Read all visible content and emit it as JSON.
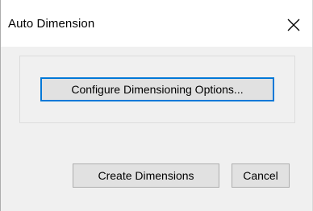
{
  "dialog": {
    "title": "Auto Dimension"
  },
  "buttons": {
    "configure_label": "Configure Dimensioning Options...",
    "create_label": "Create Dimensions",
    "cancel_label": "Cancel"
  },
  "icons": {
    "close": "close-icon"
  },
  "colors": {
    "title_bar_background": "#ffffff",
    "dialog_background": "#f0f0f0",
    "button_face": "#e1e1e1",
    "button_border": "#adadad",
    "focus_accent": "#0078d7"
  }
}
